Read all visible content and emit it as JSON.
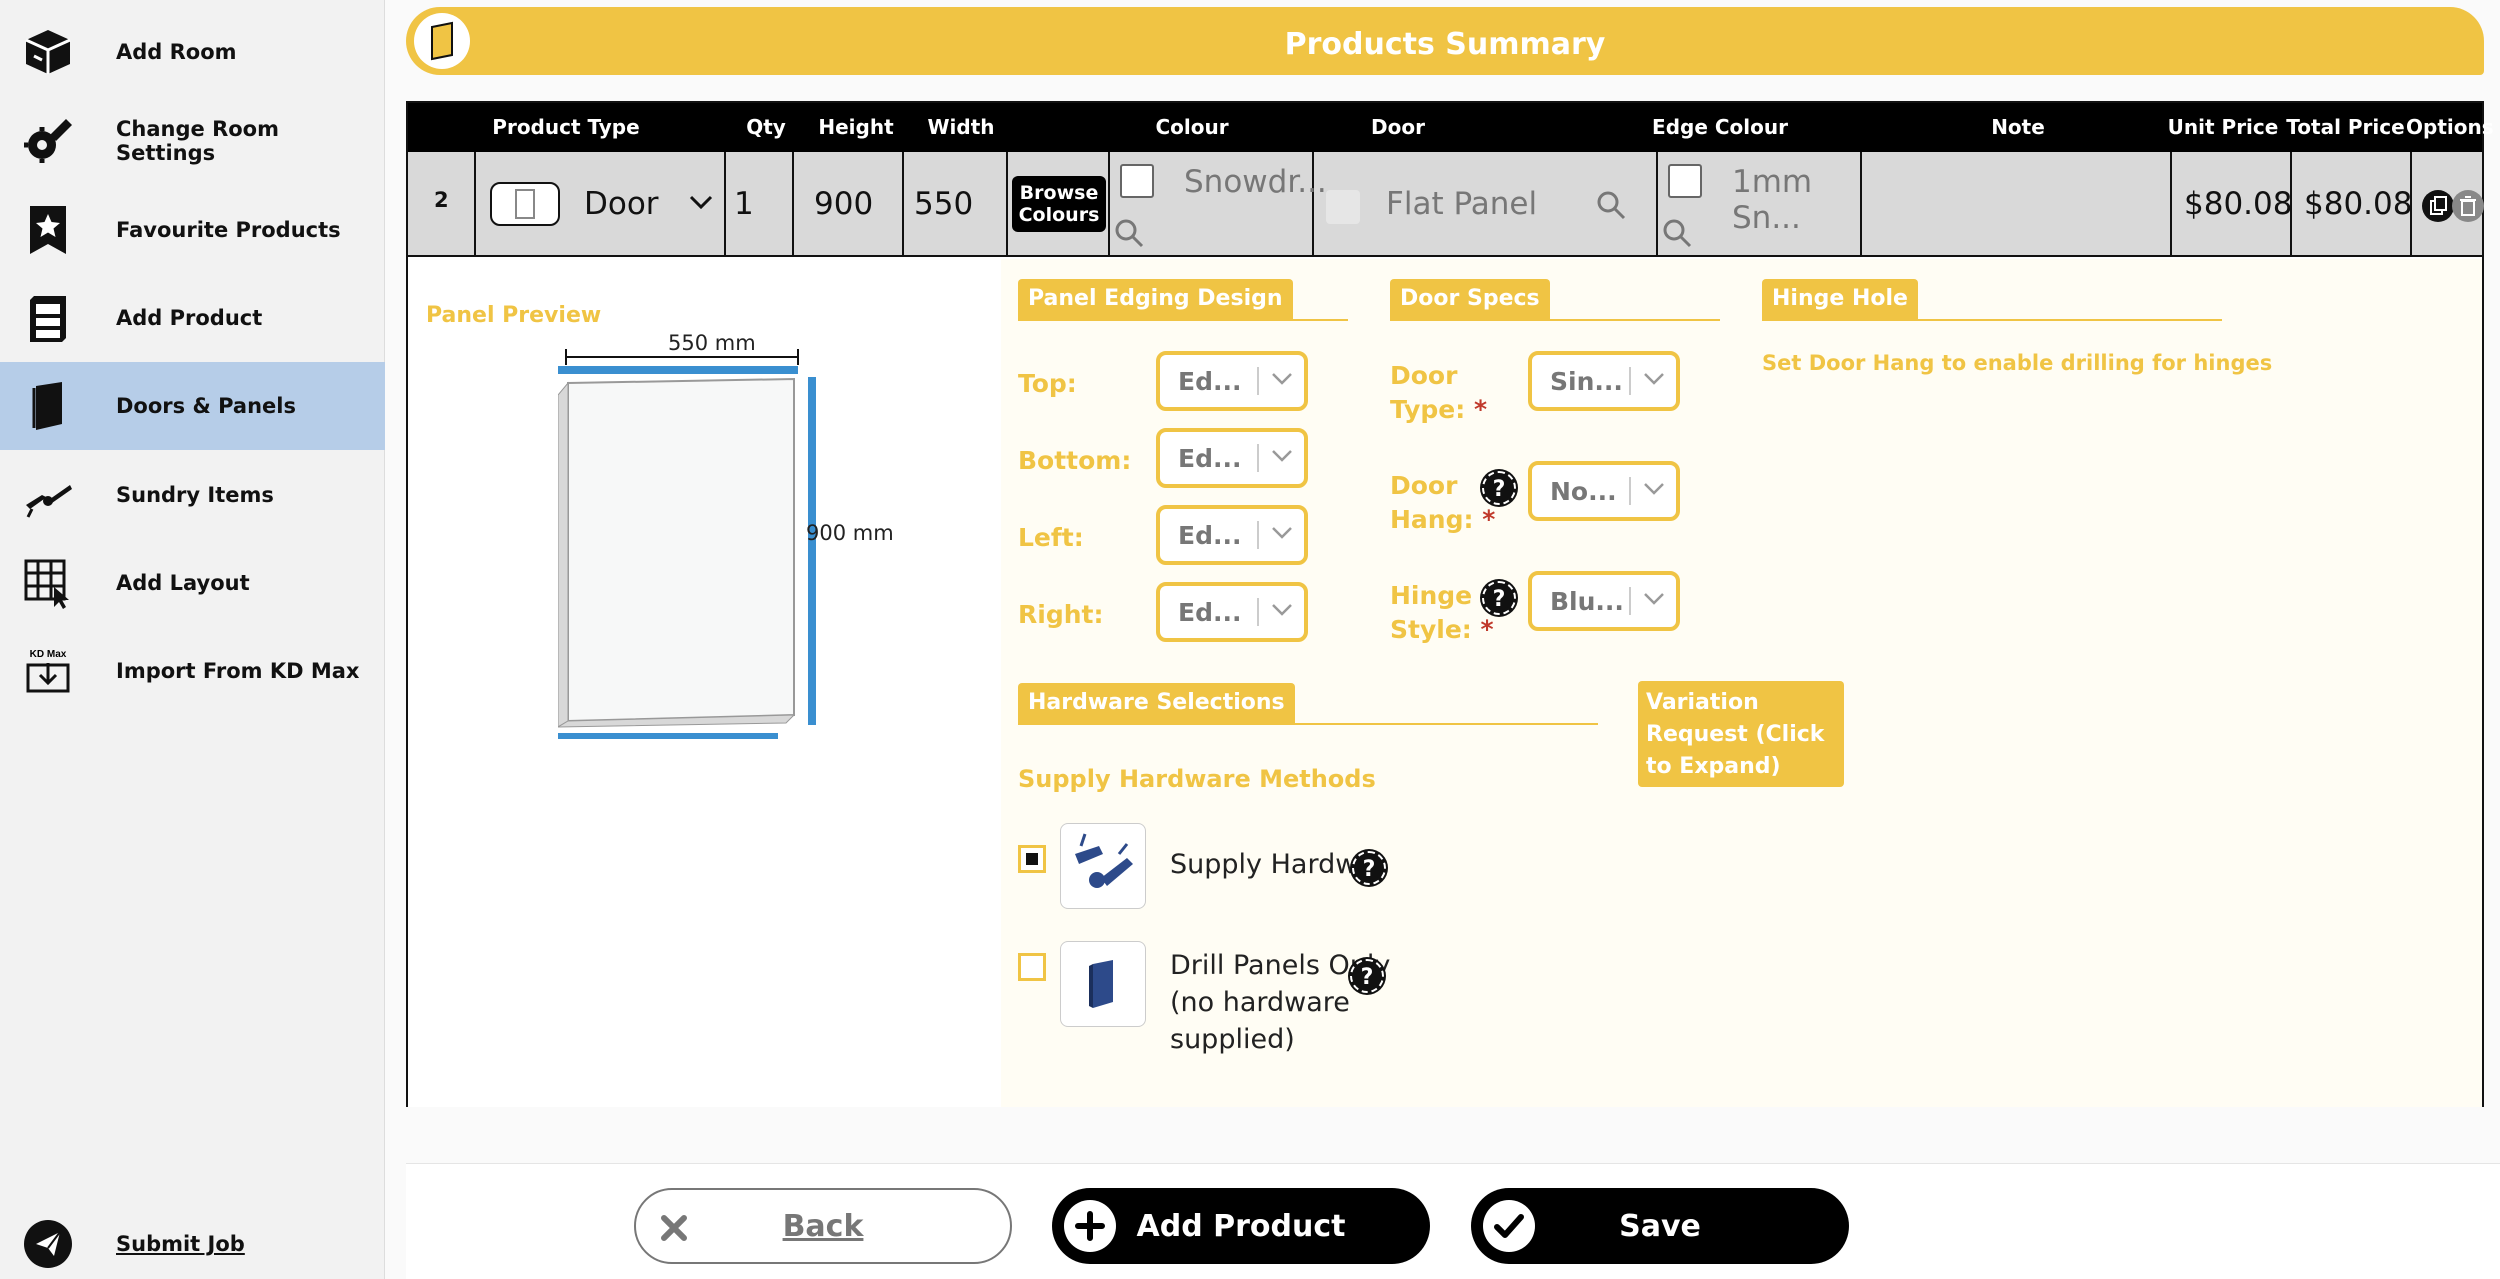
{
  "sidebar": {
    "items": [
      {
        "label": "Add Room",
        "icon": "box-icon"
      },
      {
        "label": "Change Room Settings",
        "icon": "settings-pencil-icon"
      },
      {
        "label": "Favourite Products",
        "icon": "star-bookmark-icon"
      },
      {
        "label": "Add Product",
        "icon": "cabinet-icon"
      },
      {
        "label": "Doors & Panels",
        "icon": "door-icon",
        "active": true
      },
      {
        "label": "Sundry Items",
        "icon": "hinge-icon"
      },
      {
        "label": "Add Layout",
        "icon": "grid-cursor-icon"
      },
      {
        "label": "Import From KD Max",
        "icon": "kd-max-import-icon"
      }
    ],
    "submit_label": "Submit Job",
    "kd_max_badge": "KD Max"
  },
  "summary": {
    "title": "Products Summary"
  },
  "table": {
    "headers": {
      "product_type": "Product Type",
      "qty": "Qty",
      "height": "Height",
      "width": "Width",
      "colour": "Colour",
      "door": "Door",
      "edge_colour": "Edge Colour",
      "note": "Note",
      "unit_price": "Unit Price",
      "total_price": "Total Price",
      "options": "Options"
    },
    "row": {
      "index": "2",
      "product_type": "Door",
      "qty": "1",
      "height": "900",
      "width": "550",
      "browse_colours": "Browse Colours",
      "colour": "Snowdr...",
      "door": "Flat Panel",
      "edge_colour": "1mm Sn...",
      "note": "",
      "unit_price": "$80.08",
      "total_price": "$80.08"
    }
  },
  "panel_preview": {
    "title": "Panel Preview",
    "width_label": "550 mm",
    "height_label": "900 mm"
  },
  "edging": {
    "title": "Panel Edging Design",
    "top_label": "Top:",
    "top_value": "Ed...",
    "bottom_label": "Bottom:",
    "bottom_value": "Ed...",
    "left_label": "Left:",
    "left_value": "Ed...",
    "right_label": "Right:",
    "right_value": "Ed..."
  },
  "door_specs": {
    "title": "Door Specs",
    "door_type_label_1": "Door",
    "door_type_label_2": "Type:",
    "door_type_value": "Sin...",
    "door_hang_label_1": "Door",
    "door_hang_label_2": "Hang:",
    "door_hang_value": "No...",
    "hinge_style_label_1": "Hinge",
    "hinge_style_label_2": "Style:",
    "hinge_style_value": "Blu...",
    "required_mark": "*",
    "help_glyph": "?"
  },
  "hinge_hole": {
    "title": "Hinge Hole",
    "message": "Set Door Hang to enable drilling for hinges"
  },
  "hardware": {
    "title": "Hardware Selections",
    "methods_title": "Supply Hardware Methods",
    "option1": "Supply Hardwa",
    "option2_line1": "Drill Panels Only",
    "option2_line2": "(no hardware",
    "option2_line3": "supplied)"
  },
  "variation": {
    "label": "Variation Request (Click to Expand)"
  },
  "buttons": {
    "back": "Back",
    "add_product": "Add Product",
    "save": "Save"
  },
  "colors": {
    "accent_yellow": "#f0c444",
    "active_nav": "#b6cde8",
    "edge_blue": "#3a8fd0"
  }
}
